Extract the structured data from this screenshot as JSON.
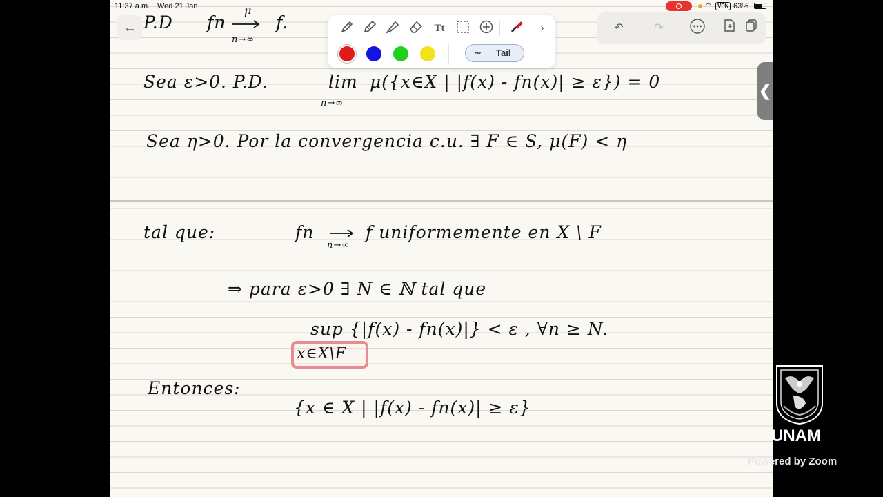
{
  "status_bar": {
    "time": "11:37 a.m.",
    "date": "Wed 21 Jan",
    "vpn": "VPN",
    "battery": "63%",
    "record_color": "#e5342f"
  },
  "toolbar": {
    "tools": [
      "pen-icon",
      "pencil-icon",
      "highlighter-icon",
      "eraser-icon",
      "text-icon",
      "lasso-icon",
      "add-icon",
      "laser-pointer-icon",
      "chevron-right-icon"
    ],
    "colors": [
      "#e01919",
      "#1414e0",
      "#20d020",
      "#f2e21a"
    ],
    "selected_color": "#e01919",
    "tail_label": "Tail"
  },
  "right_tools": [
    "undo-icon",
    "redo-icon",
    "more-icon",
    "add-page-icon",
    "copy-icon"
  ],
  "notes": {
    "line1_a": "P.D",
    "line1_b": "fn",
    "line1_c": "f.",
    "line1_mu": "μ",
    "line1_sub": "n→∞",
    "line2": "Sea  ε>0.   P.D.",
    "line2_lim": "lim",
    "line2_rest": "μ({x∈X | |f(x) - fn(x)| ≥ ε}) = 0",
    "line2_sub": "n→∞",
    "line3": "Sea   η>0.  Por   la   convergencia   c.u.   ∃ F ∈ S,  μ(F) < η",
    "line4_a": "tal  que:",
    "line4_b": "fn",
    "line4_c": "f    uniformemente    en   X \\ F",
    "line4_sub": "n→∞",
    "line5": "⇒ para   ε>0   ∃ N ∈ ℕ   tal   que",
    "line6": "sup {|f(x) - fn(x)|}  <  ε      ,  ∀n ≥ N.",
    "line6_sub": "x∈X\\F",
    "line7": "Entonces:",
    "line8": "{x ∈ X | |f(x) - fn(x)| ≥ ε}"
  },
  "branding": {
    "logo": "unam-seal-icon",
    "name": "UNAM",
    "zoom": "Powered by Zoom"
  }
}
